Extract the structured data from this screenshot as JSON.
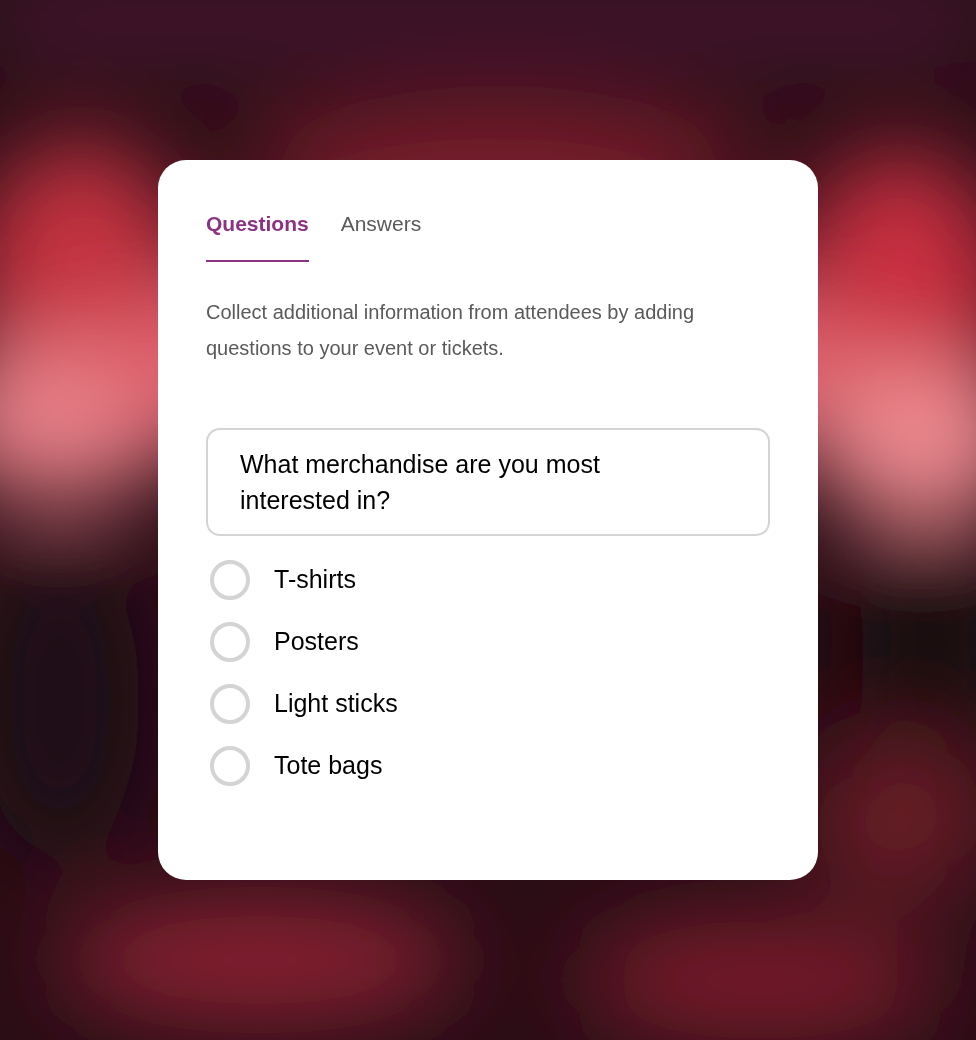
{
  "tabs": [
    {
      "label": "Questions",
      "selected": true
    },
    {
      "label": "Answers",
      "selected": false
    }
  ],
  "description": "Collect additional information from attendees by adding questions to your event or tickets.",
  "question": {
    "value": "What merchandise are you most interested in?"
  },
  "options": [
    {
      "label": "T-shirts",
      "selected": false
    },
    {
      "label": "Posters",
      "selected": false
    },
    {
      "label": "Light sticks",
      "selected": false
    },
    {
      "label": "Tote bags",
      "selected": false
    }
  ]
}
